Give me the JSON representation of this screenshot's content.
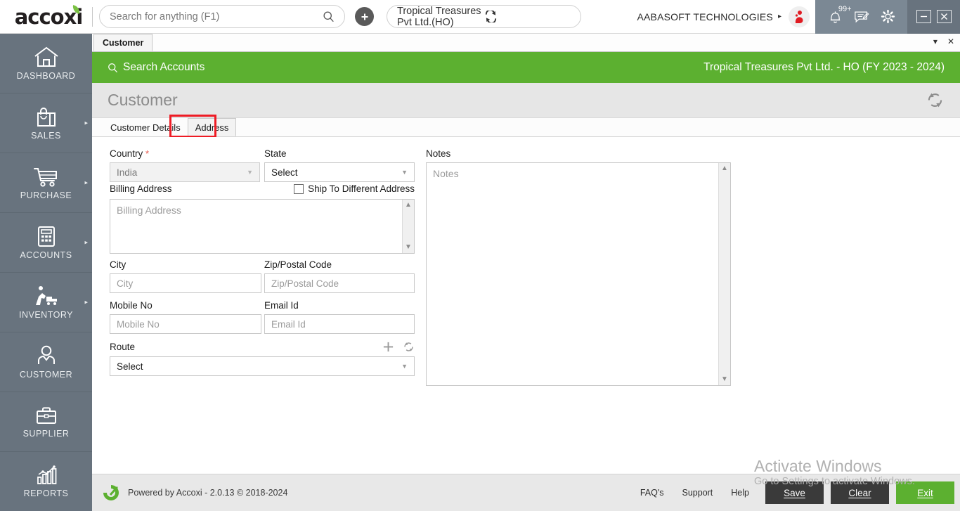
{
  "topbar": {
    "logo_text": "accoxi",
    "search": {
      "placeholder": "Search for anything (F1)",
      "value": ""
    },
    "add_icon": "plus-circle-icon",
    "search_icon": "search-icon",
    "branch": {
      "value": "Tropical Treasures Pvt Ltd.(HO)",
      "switch_icon": "switch-branch-icon"
    },
    "company_name": "AABASOFT TECHNOLOGIES",
    "company_caret": "▸",
    "avatar_icon": "user-avatar-icon",
    "notification_badge": "99+",
    "icons": {
      "bell": "bell-icon",
      "message": "message-icon",
      "settings": "gear-icon",
      "minimize": "minimize-icon",
      "close": "close-icon"
    }
  },
  "sidebar": {
    "items": [
      {
        "label": "DASHBOARD",
        "icon": "home-icon",
        "has_arrow": false
      },
      {
        "label": "SALES",
        "icon": "shopping-bag-icon",
        "has_arrow": true
      },
      {
        "label": "PURCHASE",
        "icon": "shopping-cart-icon",
        "has_arrow": true
      },
      {
        "label": "ACCOUNTS",
        "icon": "calculator-icon",
        "has_arrow": true
      },
      {
        "label": "INVENTORY",
        "icon": "warehouse-worker-icon",
        "has_arrow": true
      },
      {
        "label": "CUSTOMER",
        "icon": "person-icon",
        "has_arrow": false
      },
      {
        "label": "SUPPLIER",
        "icon": "briefcase-icon",
        "has_arrow": false
      },
      {
        "label": "REPORTS",
        "icon": "bar-chart-icon",
        "has_arrow": false
      }
    ]
  },
  "window_tabs": {
    "tabs": [
      {
        "label": "Customer"
      }
    ],
    "dropdown_icon": "▾",
    "close_icon": "✕"
  },
  "greenbar": {
    "search_accounts": "Search Accounts",
    "search_icon": "search-icon",
    "company_fy": "Tropical Treasures Pvt Ltd. - HO (FY 2023 - 2024)",
    "color": "#5cb030"
  },
  "page": {
    "title": "Customer",
    "refresh_icon": "refresh-icon"
  },
  "form_tabs": {
    "items": [
      {
        "label": "Customer Details",
        "active": false
      },
      {
        "label": "Address",
        "active": true
      }
    ],
    "highlight_color": "#ee1c25"
  },
  "form": {
    "country": {
      "label": "Country",
      "required": "*",
      "value": "India",
      "disabled": true
    },
    "state": {
      "label": "State",
      "value": "Select"
    },
    "billing_address": {
      "label": "Billing Address",
      "placeholder": "Billing Address",
      "value": ""
    },
    "ship_to_different": {
      "label": "Ship To Different Address",
      "checked": false
    },
    "city": {
      "label": "City",
      "placeholder": "City",
      "value": ""
    },
    "zip": {
      "label": "Zip/Postal Code",
      "placeholder": "Zip/Postal Code",
      "value": ""
    },
    "mobile": {
      "label": "Mobile No",
      "placeholder": "Mobile No",
      "value": ""
    },
    "email": {
      "label": "Email Id",
      "placeholder": "Email Id",
      "value": ""
    },
    "route": {
      "label": "Route",
      "value": "Select",
      "add_icon": "plus-icon",
      "refresh_icon": "refresh-icon"
    },
    "notes": {
      "label": "Notes",
      "placeholder": "Notes",
      "value": ""
    }
  },
  "watermark": {
    "line1": "Activate Windows",
    "line2": "Go to Settings to activate Windows."
  },
  "footer": {
    "logo_icon": "accoxi-mark-icon",
    "powered_by": "Powered by Accoxi - 2.0.13 © 2018-2024",
    "links": [
      "FAQ's",
      "Support",
      "Help"
    ],
    "buttons": [
      {
        "label": "Save",
        "accel": "S",
        "style": "dark"
      },
      {
        "label": "Clear",
        "accel": "C",
        "style": "dark"
      },
      {
        "label": "Exit",
        "accel": "E",
        "style": "green"
      }
    ]
  }
}
